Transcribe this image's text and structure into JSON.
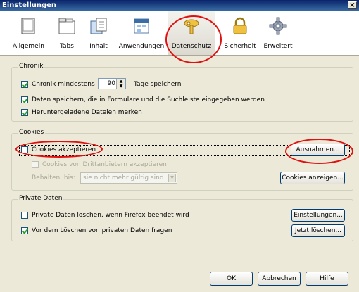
{
  "window": {
    "title": "Einstellungen",
    "close_label": "×"
  },
  "toolbar": {
    "items": [
      {
        "label": "Allgemein",
        "icon": "window-icon"
      },
      {
        "label": "Tabs",
        "icon": "tabs-icon"
      },
      {
        "label": "Inhalt",
        "icon": "content-icon"
      },
      {
        "label": "Anwendungen",
        "icon": "applications-icon"
      },
      {
        "label": "Datenschutz",
        "icon": "privacy-mask-icon",
        "active": true
      },
      {
        "label": "Sicherheit",
        "icon": "lock-icon"
      },
      {
        "label": "Erweitert",
        "icon": "gear-icon"
      }
    ]
  },
  "chronik": {
    "legend": "Chronik",
    "history_label": "Chronik mindestens",
    "history_days": "90",
    "history_suffix": "Tage speichern",
    "form_label": "Daten speichern, die in Formulare und die Suchleiste eingegeben werden",
    "downloads_label": "Heruntergeladene Dateien merken"
  },
  "cookies": {
    "legend": "Cookies",
    "accept_label": "Cookies akzeptieren",
    "exceptions_button": "Ausnahmen...",
    "third_party_label": "Cookies von Drittanbietern akzeptieren",
    "keep_label": "Behalten, bis:",
    "keep_value": "sie nicht mehr gültig sind",
    "show_button": "Cookies anzeigen..."
  },
  "private": {
    "legend": "Private Daten",
    "clear_on_exit_label": "Private Daten löschen, wenn Firefox beendet wird",
    "settings_button": "Einstellungen...",
    "ask_label": "Vor dem Löschen von privaten Daten fragen",
    "clear_now_button": "Jetzt löschen..."
  },
  "footer": {
    "ok": "OK",
    "cancel": "Abbrechen",
    "help": "Hilfe"
  },
  "colors": {
    "title_bar": "#0a246a",
    "annotation_red": "#e01010",
    "window_bg": "#ece9d8"
  }
}
